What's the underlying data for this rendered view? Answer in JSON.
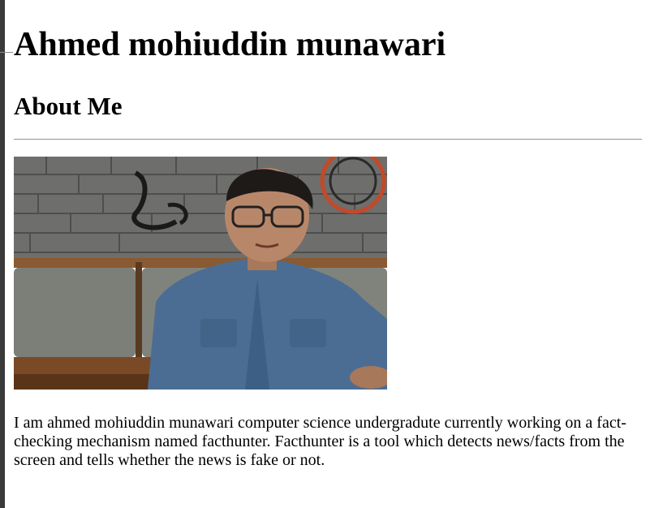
{
  "header": {
    "title": "Ahmed mohiuddin munawari",
    "subtitle": "About Me"
  },
  "profile_photo": {
    "icon": "profile-photo"
  },
  "bio": {
    "text": "I am ahmed mohiuddin munawari computer science undergradute currently working on a fact-checking mechanism named facthunter. Facthunter is a tool which detects news/facts from the screen and tells whether the news is fake or not."
  },
  "colors": {
    "text": "#000000",
    "background": "#ffffff",
    "rule": "#9a9a9a"
  }
}
